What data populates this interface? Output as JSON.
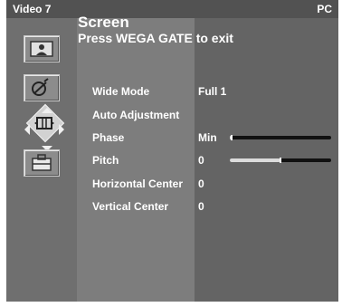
{
  "header": {
    "left_label": "Video 7",
    "right_label": "PC"
  },
  "menu": {
    "title": "Screen",
    "subtitle": "Press WEGA GATE to exit",
    "rows": [
      {
        "label": "Wide Mode",
        "value": "Full 1"
      },
      {
        "label": "Auto Adjustment",
        "value": ""
      },
      {
        "label": "Phase",
        "value": "Min",
        "slider": 0.02
      },
      {
        "label": "Pitch",
        "value": "0",
        "slider": 0.5
      },
      {
        "label": "Horizontal Center",
        "value": "0"
      },
      {
        "label": "Vertical Center",
        "value": "0"
      }
    ]
  },
  "icons": [
    {
      "name": "picture-icon",
      "selected": false
    },
    {
      "name": "sound-icon",
      "selected": false
    },
    {
      "name": "screen-icon",
      "selected": true
    },
    {
      "name": "setup-icon",
      "selected": false
    }
  ],
  "colors": {
    "topbar": "#525252",
    "panel": "#7d7d7d",
    "panel_dark": "#646464",
    "text": "#ffffff"
  }
}
